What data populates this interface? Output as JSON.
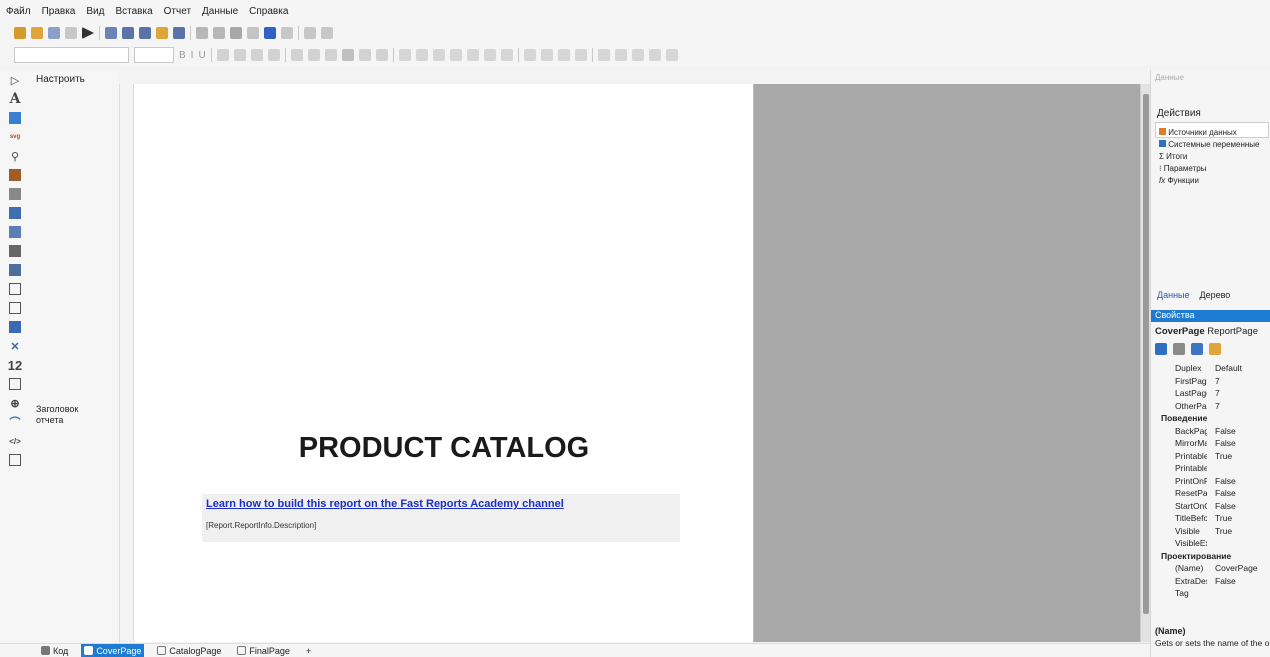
{
  "menu": [
    "Файл",
    "Правка",
    "Вид",
    "Вставка",
    "Отчет",
    "Данные",
    "Справка"
  ],
  "left_panel": {
    "configure_label": "Настроить",
    "band_label_line1": "Заголовок",
    "band_label_line2": "отчета",
    "tools": [
      "A",
      "svg",
      "12",
      "</>"
    ]
  },
  "canvas": {
    "title": "PRODUCT CATALOG",
    "link_text": "Learn how to build this report on the Fast Reports Academy channel",
    "description_expr": "[Report.ReportInfo.Description]"
  },
  "right_panel": {
    "data_header": "Данные",
    "actions_label": "Действия",
    "tree": [
      "Источники данных",
      "Системные переменные",
      "Итоги",
      "Параметры",
      "Функции"
    ],
    "tabs": [
      "Данные",
      "Дерево"
    ],
    "props_header": "Свойства",
    "selected": "CoverPage",
    "selected_type": "ReportPage",
    "properties": [
      {
        "name": "Duplex",
        "value": "Default"
      },
      {
        "name": "FirstPageSource",
        "value": "7"
      },
      {
        "name": "LastPageSource",
        "value": "7"
      },
      {
        "name": "OtherPagesSource",
        "value": "7"
      },
      {
        "category": "Поведение"
      },
      {
        "name": "BackPage",
        "value": "False"
      },
      {
        "name": "MirrorMargins",
        "value": "False"
      },
      {
        "name": "Printable",
        "value": "True"
      },
      {
        "name": "PrintableExpression",
        "value": ""
      },
      {
        "name": "PrintOnPreviousPage",
        "value": "False"
      },
      {
        "name": "ResetPageNumber",
        "value": "False"
      },
      {
        "name": "StartOnOddPage",
        "value": "False"
      },
      {
        "name": "TitleBeforeHeader",
        "value": "True"
      },
      {
        "name": "Visible",
        "value": "True"
      },
      {
        "name": "VisibleExpression",
        "value": ""
      },
      {
        "category": "Проектирование"
      },
      {
        "name": "(Name)",
        "value": "CoverPage"
      },
      {
        "name": "ExtraDesignWidth",
        "value": "False"
      },
      {
        "name": "Tag",
        "value": ""
      }
    ],
    "desc_title": "(Name)",
    "desc_text": "Gets or sets the name of the object"
  },
  "bottom_tabs": [
    "Код",
    "CoverPage",
    "CatalogPage",
    "FinalPage",
    "+"
  ],
  "colors": {
    "accent": "#1e7bd4",
    "link": "#1a2ec8",
    "canvas": "#ffffff",
    "gray_area": "#a8a8a8"
  }
}
